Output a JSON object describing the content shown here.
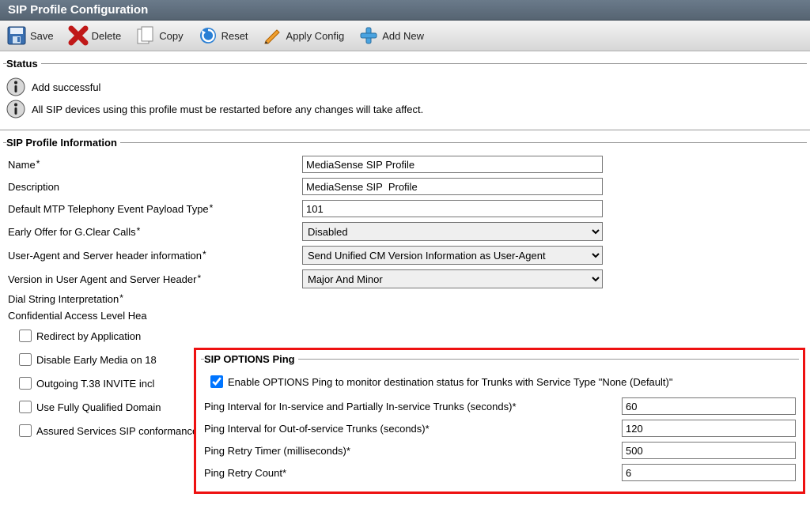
{
  "title": "SIP Profile Configuration",
  "toolbar": {
    "save": "Save",
    "delete": "Delete",
    "copy": "Copy",
    "reset": "Reset",
    "applyConfig": "Apply Config",
    "addNew": "Add New"
  },
  "status": {
    "legend": "Status",
    "msg1": "Add successful",
    "msg2": "All SIP devices using this profile must be restarted before any changes will take affect."
  },
  "profile": {
    "legend": "SIP Profile Information",
    "labels": {
      "name": "Name",
      "description": "Description",
      "defaultMtp": "Default MTP Telephony Event Payload Type",
      "earlyOffer": "Early Offer for G.Clear Calls",
      "userAgent": "User-Agent and Server header information",
      "version": "Version in User Agent and Server Header",
      "dialString": "Dial String Interpretation",
      "cal": "Confidential Access Level Hea"
    },
    "values": {
      "name": "MediaSense SIP Profile",
      "description": "MediaSense SIP  Profile",
      "defaultMtp": "101",
      "earlyOffer": "Disabled",
      "userAgent": "Send Unified CM Version Information as User-Agent",
      "version": "Major And Minor"
    },
    "checks": {
      "redirect": "Redirect by Application",
      "disableEarly": "Disable Early Media on 18",
      "outgoingT38": "Outgoing T.38 INVITE incl",
      "useFQDN": "Use Fully Qualified Domain",
      "assured": "Assured Services SIP conformance"
    }
  },
  "optionsPing": {
    "legend": "SIP OPTIONS Ping",
    "enableLabel": "Enable OPTIONS Ping to monitor destination status for Trunks with Service Type \"None (Default)\"",
    "labels": {
      "intervalIn": "Ping Interval for In-service and Partially In-service Trunks (seconds)",
      "intervalOut": "Ping Interval for Out-of-service Trunks (seconds)",
      "retryTimer": "Ping Retry Timer (milliseconds)",
      "retryCount": "Ping Retry Count"
    },
    "values": {
      "intervalIn": "60",
      "intervalOut": "120",
      "retryTimer": "500",
      "retryCount": "6"
    }
  }
}
